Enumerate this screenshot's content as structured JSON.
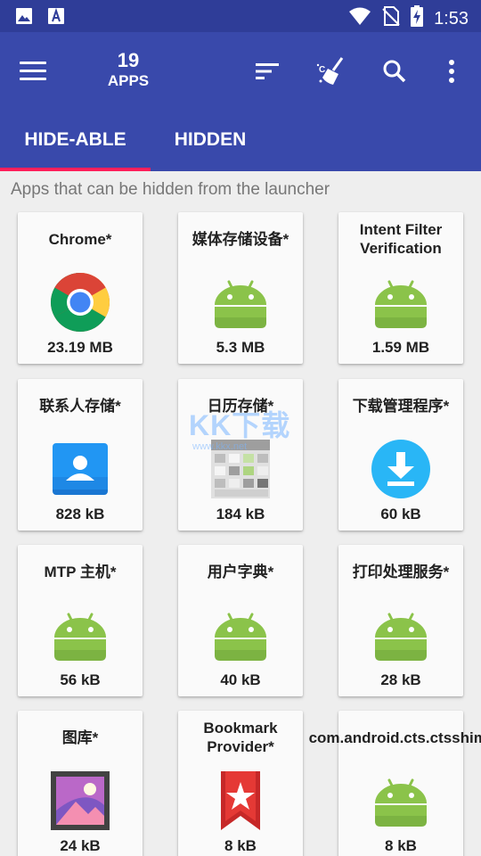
{
  "status_bar": {
    "time": "1:53",
    "left_icons": [
      "image-icon",
      "text-a-icon"
    ],
    "right_icons": [
      "wifi-icon",
      "no-sim-icon",
      "battery-charging-icon"
    ]
  },
  "app_bar": {
    "count": "19",
    "count_label": "APPS",
    "actions": [
      "sort-icon",
      "clean-icon",
      "search-icon",
      "more-vert-icon"
    ],
    "color": "#3949ab",
    "status_color": "#2f3d98"
  },
  "tabs": [
    {
      "label": "HIDE-ABLE",
      "selected": true
    },
    {
      "label": "HIDDEN",
      "selected": false
    }
  ],
  "accent": "#ff1f5b",
  "subtitle": "Apps that can be hidden from the launcher",
  "apps": [
    {
      "name": "Chrome*",
      "size": "23.19 MB",
      "icon": "chrome-icon"
    },
    {
      "name": "媒体存储设备*",
      "size": "5.3 MB",
      "icon": "android-icon"
    },
    {
      "name": "Intent Filter Verification",
      "size": "1.59 MB",
      "icon": "android-icon"
    },
    {
      "name": "联系人存储*",
      "size": "828 kB",
      "icon": "contacts-icon"
    },
    {
      "name": "日历存储*",
      "size": "184 kB",
      "icon": "calendar-icon"
    },
    {
      "name": "下载管理程序*",
      "size": "60 kB",
      "icon": "download-icon"
    },
    {
      "name": "MTP 主机*",
      "size": "56 kB",
      "icon": "android-icon"
    },
    {
      "name": "用户字典*",
      "size": "40 kB",
      "icon": "android-icon"
    },
    {
      "name": "打印处理服务*",
      "size": "28 kB",
      "icon": "android-icon"
    },
    {
      "name": "图库*",
      "size": "24 kB",
      "icon": "gallery-icon"
    },
    {
      "name": "Bookmark Provider*",
      "size": "8 kB",
      "icon": "bookmark-icon"
    },
    {
      "name": "com.android.cts.ctsshim*",
      "size": "8 kB",
      "icon": "android-icon"
    }
  ],
  "watermark": {
    "text": "KK下载",
    "sub": "www.kkx.net"
  }
}
